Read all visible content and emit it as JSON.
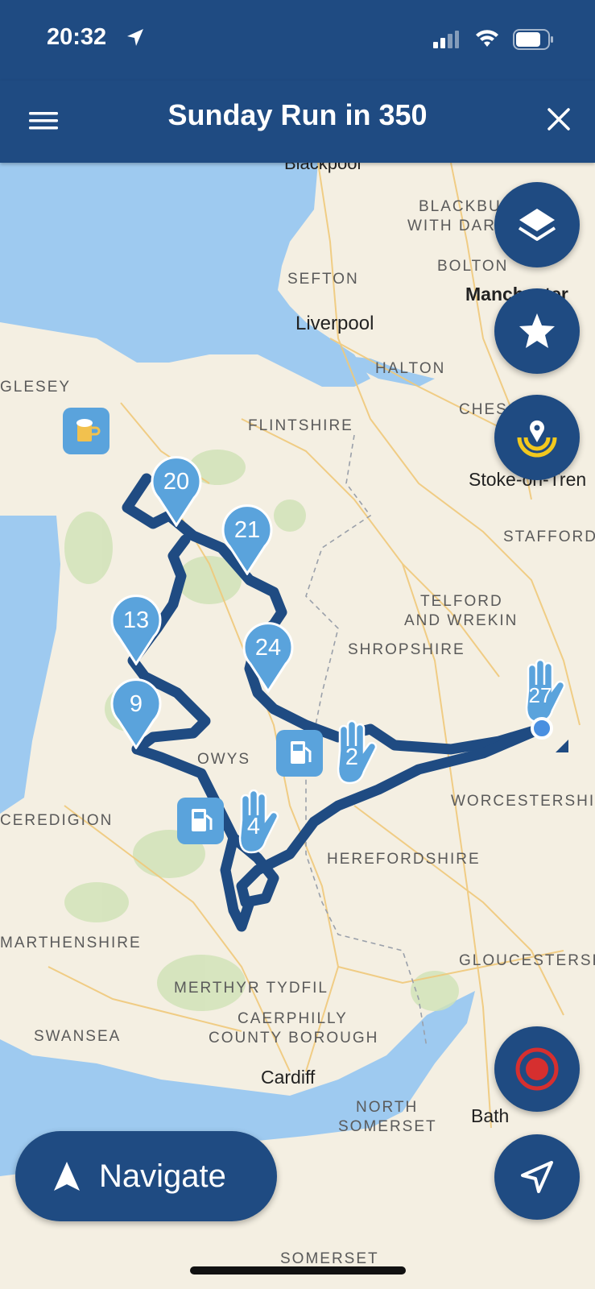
{
  "status_bar": {
    "time": "20:32"
  },
  "header": {
    "title": "Sunday Run in 350"
  },
  "map": {
    "regions": [
      {
        "id": "blackpool",
        "label": "Blackpool"
      },
      {
        "id": "blackburn",
        "label": "BLACKBU"
      },
      {
        "id": "withdar",
        "label": "WITH DAR"
      },
      {
        "id": "bolton",
        "label": "BOLTON"
      },
      {
        "id": "sefton",
        "label": "SEFTON"
      },
      {
        "id": "manchester",
        "label": "Manchester"
      },
      {
        "id": "liverpool",
        "label": "Liverpool"
      },
      {
        "id": "halton",
        "label": "HALTON"
      },
      {
        "id": "anglesey",
        "label": "GLESEY"
      },
      {
        "id": "cheshire",
        "label": "CHES"
      },
      {
        "id": "flintshire",
        "label": "FLINTSHIRE"
      },
      {
        "id": "stoke",
        "label": "Stoke-on-Tren"
      },
      {
        "id": "stafford",
        "label": "STAFFORD"
      },
      {
        "id": "telford",
        "label": "TELFORD"
      },
      {
        "id": "wrekin",
        "label": "AND WREKIN"
      },
      {
        "id": "shropshire",
        "label": "SHROPSHIRE"
      },
      {
        "id": "powys",
        "label": "OWYS"
      },
      {
        "id": "ceredigion",
        "label": "CEREDIGION"
      },
      {
        "id": "worcestershire",
        "label": "WORCESTERSHIR"
      },
      {
        "id": "herefordshire",
        "label": "HEREFORDSHIRE"
      },
      {
        "id": "carmarthenshire",
        "label": "MARTHENSHIRE"
      },
      {
        "id": "gloucestershire",
        "label": "GLOUCESTERSH"
      },
      {
        "id": "merthyr",
        "label": "MERTHYR TYDFIL"
      },
      {
        "id": "caerphilly",
        "label": "CAERPHILLY"
      },
      {
        "id": "county",
        "label": "COUNTY BOROUGH"
      },
      {
        "id": "swansea",
        "label": "SWANSEA"
      },
      {
        "id": "cardiff",
        "label": "Cardiff"
      },
      {
        "id": "northsom",
        "label": "NORTH"
      },
      {
        "id": "somerset",
        "label": "SOMERSET"
      },
      {
        "id": "bath",
        "label": "Bath"
      },
      {
        "id": "somerset2",
        "label": "SOMERSET"
      }
    ],
    "waypoints": [
      {
        "id": "wp20",
        "label": "20"
      },
      {
        "id": "wp21",
        "label": "21"
      },
      {
        "id": "wp13",
        "label": "13"
      },
      {
        "id": "wp24",
        "label": "24"
      },
      {
        "id": "wp9",
        "label": "9"
      }
    ],
    "stop_markers": [
      {
        "id": "stop2",
        "label": "2"
      },
      {
        "id": "stop4",
        "label": "4"
      },
      {
        "id": "stop27",
        "label": "27"
      }
    ],
    "poi_icons": [
      "beer-icon",
      "fuel-icon",
      "fuel-icon"
    ]
  },
  "controls": {
    "navigate_label": "Navigate",
    "layers_icon": "layers-icon",
    "favorites_icon": "star-icon",
    "recenter_icon": "location-target-icon",
    "record_icon": "record-icon",
    "locate_icon": "navigation-arrow-icon"
  },
  "colors": {
    "header": "#1f4b82",
    "route": "#1f4b82",
    "waypoint": "#5aa3dc",
    "poi": "#5aa3dc",
    "water": "#9ecaf0",
    "land": "#f4efe2"
  }
}
